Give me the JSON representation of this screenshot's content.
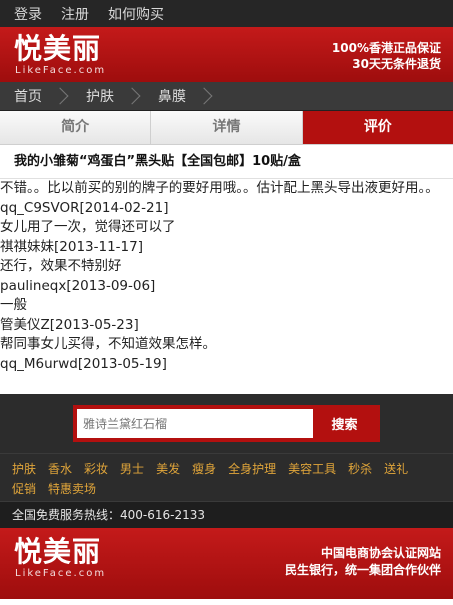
{
  "topbar": {
    "links": [
      "登录",
      "注册",
      "如何购买"
    ]
  },
  "brand": {
    "logo_cn": "悦美丽",
    "logo_en": "LikeFace.com",
    "tagline1": "100%香港正品保证",
    "tagline2": "30天无条件退货"
  },
  "breadcrumb": [
    "首页",
    "护肤",
    "鼻膜"
  ],
  "tabs": {
    "intro": "简介",
    "details": "详情",
    "reviews": "评价",
    "active": "reviews"
  },
  "product": {
    "title": "我的小雏菊“鸡蛋白”黑头贴【全国包邮】10贴/盒"
  },
  "reviews": [
    {
      "type": "content",
      "text": "不错。。比以前买的别的牌子的要好用哦。。估计配上黑头导出液更好用。。"
    },
    {
      "type": "author",
      "text": "qq_C9SVOR[2014-02-21]"
    },
    {
      "type": "content",
      "text": "女儿用了一次，觉得还可以了"
    },
    {
      "type": "author",
      "text": "祺祺妹妹[2013-11-17]"
    },
    {
      "type": "content",
      "text": "还行，效果不特别好"
    },
    {
      "type": "author",
      "text": "paulineqx[2013-09-06]"
    },
    {
      "type": "content",
      "text": "一般"
    },
    {
      "type": "author",
      "text": "管美仪Z[2013-05-23]"
    },
    {
      "type": "content",
      "text": "帮同事女儿买得，不知道效果怎样。"
    },
    {
      "type": "author",
      "text": "qq_M6urwd[2013-05-19]"
    }
  ],
  "search": {
    "placeholder": "雅诗兰黛红石榴",
    "button": "搜索"
  },
  "categories": {
    "row1": [
      "护肤",
      "香水",
      "彩妆",
      "男士",
      "美发",
      "瘦身",
      "全身护理",
      "美容工具",
      "秒杀",
      "送礼"
    ],
    "row2": [
      "促销",
      "特惠卖场"
    ]
  },
  "hotline": "全国免费服务热线：400-616-2133",
  "footer": {
    "logo_cn": "悦美丽",
    "logo_en": "LikeFace.com",
    "line1": "中国电商协会认证网站",
    "line2": "民生银行，统一集团合作伙伴"
  },
  "colors": {
    "brand_red": "#b3100f",
    "category_gold": "#e0a53a",
    "dark_bg": "#2c2c2c"
  }
}
